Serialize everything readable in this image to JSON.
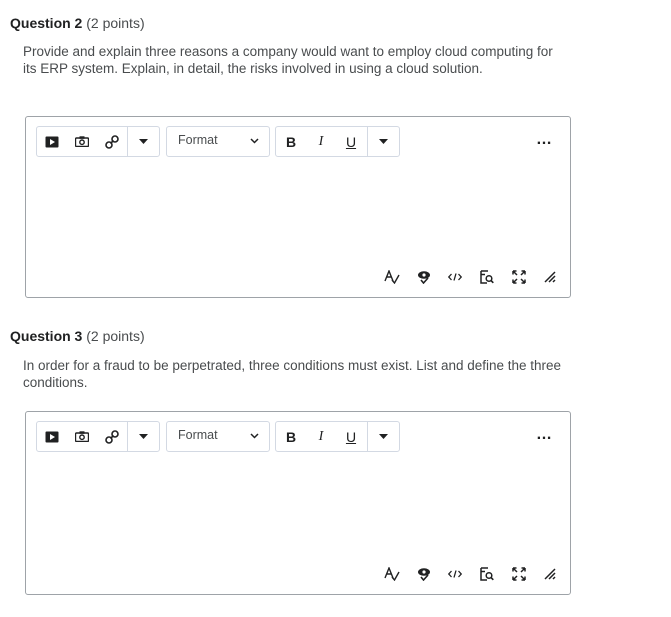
{
  "questions": [
    {
      "title": "Question 2",
      "points": "(2 points)",
      "text": "Provide and explain three reasons a company would want to employ cloud computing for its ERP system.  Explain, in detail, the risks involved in using a cloud solution.",
      "format_label": "Format"
    },
    {
      "title": "Question 3",
      "points": "(2 points)",
      "text": "In order for a fraud to be perpetrated, three conditions must exist. List and define the three conditions.",
      "format_label": "Format"
    }
  ],
  "toolbar": {
    "bold_label": "B",
    "italic_label": "I",
    "underline_label": "U",
    "more_label": "…"
  },
  "icons": {
    "insert_media": "video-icon",
    "insert_image": "camera-icon",
    "insert_link": "link-icon",
    "spellcheck": "spellcheck-icon",
    "accessibility": "accessibility-icon",
    "source_code": "source-code-icon",
    "preview": "preview-icon",
    "fullscreen": "fullscreen-icon",
    "resize": "resize-handle-icon"
  }
}
